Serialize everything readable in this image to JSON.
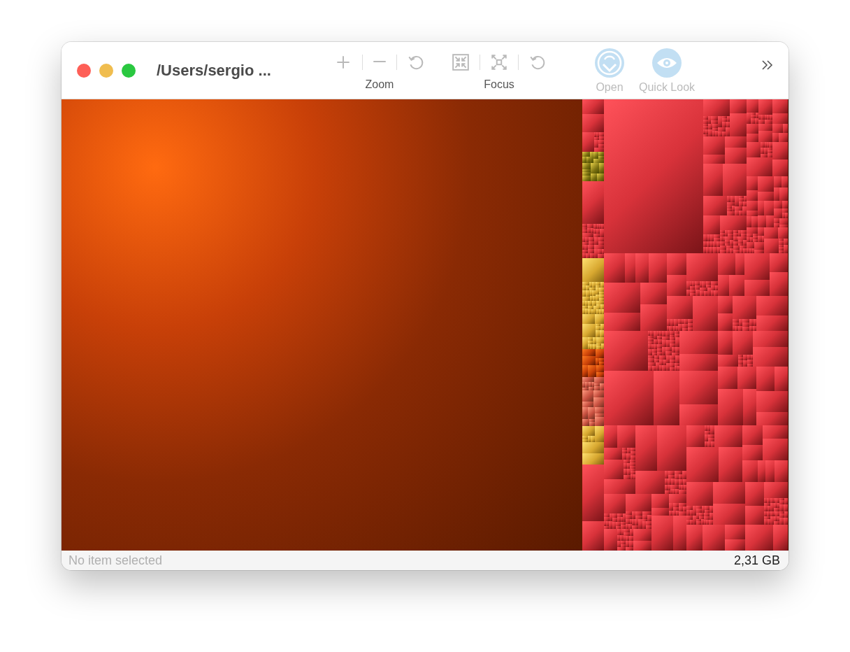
{
  "window": {
    "title": "/Users/sergio ..."
  },
  "toolbar": {
    "groups": [
      {
        "label": "Zoom",
        "items": [
          {
            "kind": "plus",
            "disabled": true
          },
          {
            "kind": "minus",
            "disabled": true
          },
          {
            "kind": "reset",
            "disabled": true
          }
        ]
      },
      {
        "label": "Focus",
        "items": [
          {
            "kind": "contract",
            "disabled": true
          },
          {
            "kind": "expand",
            "disabled": true
          },
          {
            "kind": "reset",
            "disabled": true
          }
        ]
      }
    ],
    "buttons": [
      {
        "kind": "open",
        "label": "Open",
        "disabled": true
      },
      {
        "kind": "quicklook",
        "label": "Quick Look",
        "disabled": true
      }
    ]
  },
  "status_bar": {
    "selection": "No item selected",
    "total": "2,31 GB"
  }
}
